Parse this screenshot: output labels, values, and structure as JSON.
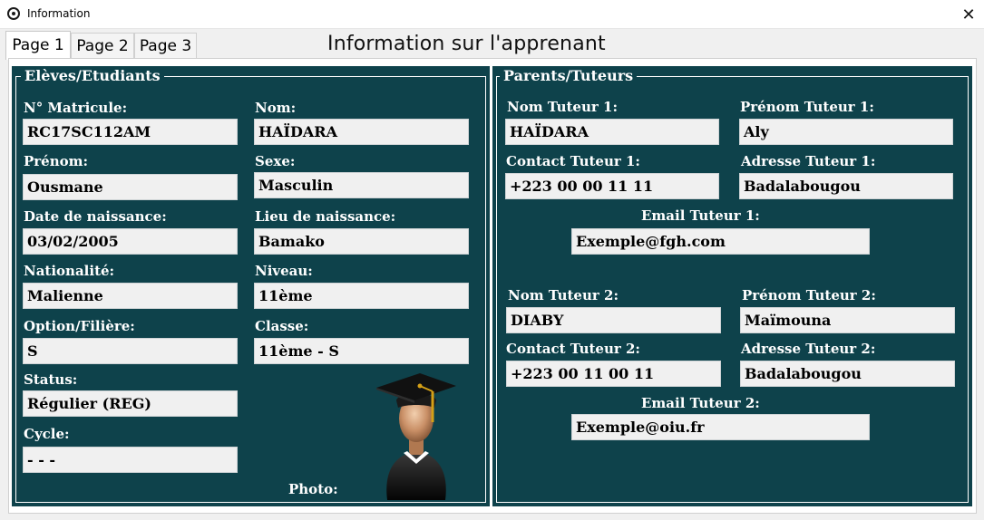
{
  "window": {
    "title": "Information",
    "close_label": "✕"
  },
  "tabs": [
    {
      "label": "Page 1",
      "active": true
    },
    {
      "label": "Page 2",
      "active": false
    },
    {
      "label": "Page 3",
      "active": false
    }
  ],
  "page_heading": "Information sur l'apprenant",
  "students": {
    "legend": "Elèves/Etudiants",
    "matricule": {
      "label": "N° Matricule:",
      "value": "RC17SC112AM"
    },
    "nom": {
      "label": "Nom:",
      "value": "HAÏDARA"
    },
    "prenom": {
      "label": "Prénom:",
      "value": "Ousmane"
    },
    "sexe": {
      "label": "Sexe:",
      "value": "Masculin"
    },
    "date_naissance": {
      "label": "Date de naissance:",
      "value": "03/02/2005"
    },
    "lieu_naissance": {
      "label": "Lieu de naissance:",
      "value": "Bamako"
    },
    "nationalite": {
      "label": "Nationalité:",
      "value": "Malienne"
    },
    "niveau": {
      "label": "Niveau:",
      "value": "11ème"
    },
    "option": {
      "label": "Option/Filière:",
      "value": "S"
    },
    "classe": {
      "label": "Classe:",
      "value": "11ème - S"
    },
    "status": {
      "label": "Status:",
      "value": "Régulier (REG)"
    },
    "cycle": {
      "label": "Cycle:",
      "value": "- - -"
    },
    "photo_label": "Photo:"
  },
  "parents": {
    "legend": "Parents/Tuteurs",
    "nom1": {
      "label": "Nom Tuteur 1:",
      "value": "HAÏDARA"
    },
    "prenom1": {
      "label": "Prénom Tuteur 1:",
      "value": "Aly"
    },
    "contact1": {
      "label": "Contact Tuteur 1:",
      "value": "+223 00 00 11 11"
    },
    "adresse1": {
      "label": "Adresse Tuteur 1:",
      "value": "Badalabougou"
    },
    "email1": {
      "label": "Email Tuteur 1:",
      "value": "Exemple@fgh.com"
    },
    "nom2": {
      "label": "Nom Tuteur 2:",
      "value": "DIABY"
    },
    "prenom2": {
      "label": "Prénom Tuteur 2:",
      "value": "Maïmouna"
    },
    "contact2": {
      "label": "Contact Tuteur 2:",
      "value": "+223 00 11 00 11"
    },
    "adresse2": {
      "label": "Adresse Tuteur 2:",
      "value": "Badalabougou"
    },
    "email2": {
      "label": "Email Tuteur 2:",
      "value": "Exemple@oiu.fr"
    }
  },
  "colors": {
    "panel_bg": "#0e424b",
    "field_bg": "#f0f0f0",
    "label_text": "#ffffff"
  },
  "icons": {
    "photo": "graduate-avatar-icon",
    "app": "app-logo-icon",
    "close": "close-icon"
  }
}
